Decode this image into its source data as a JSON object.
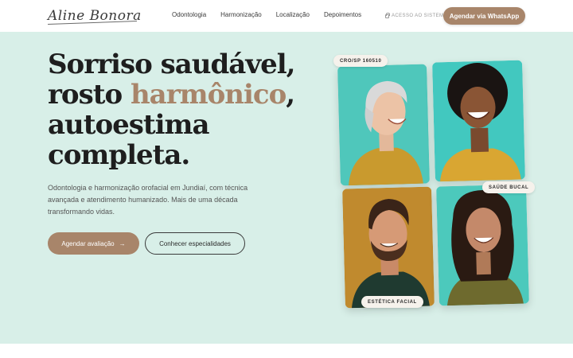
{
  "header": {
    "logo": "Aline Bonora",
    "nav": [
      "Odontologia",
      "Harmonização",
      "Localização",
      "Depoimentos"
    ],
    "access_label": "ACESSO AO SISTEMA",
    "whatsapp_button": "Agendar via WhatsApp"
  },
  "hero": {
    "headline_line1": "Sorriso saudável,",
    "headline_line2a": "rosto ",
    "headline_line2b": "harmônico",
    "headline_line2c": ",",
    "headline_line3": "autoestima",
    "headline_line4": "completa.",
    "description": "Odontologia e harmonização orofacial em Jundiaí, com técnica avançada e atendimento humanizado. Mais de uma década transformando vidas.",
    "primary_button": "Agendar avaliação",
    "primary_arrow": "→",
    "secondary_button": "Conhecer especialidades"
  },
  "tags": {
    "cro": "CRO/SP 160510",
    "saude": "SAÚDE BUCAL",
    "estetica": "ESTÉTICA FACIAL"
  },
  "colors": {
    "accent": "#a8856a",
    "hero_bg": "#d8efe8",
    "text_dark": "#1e1e1e"
  }
}
